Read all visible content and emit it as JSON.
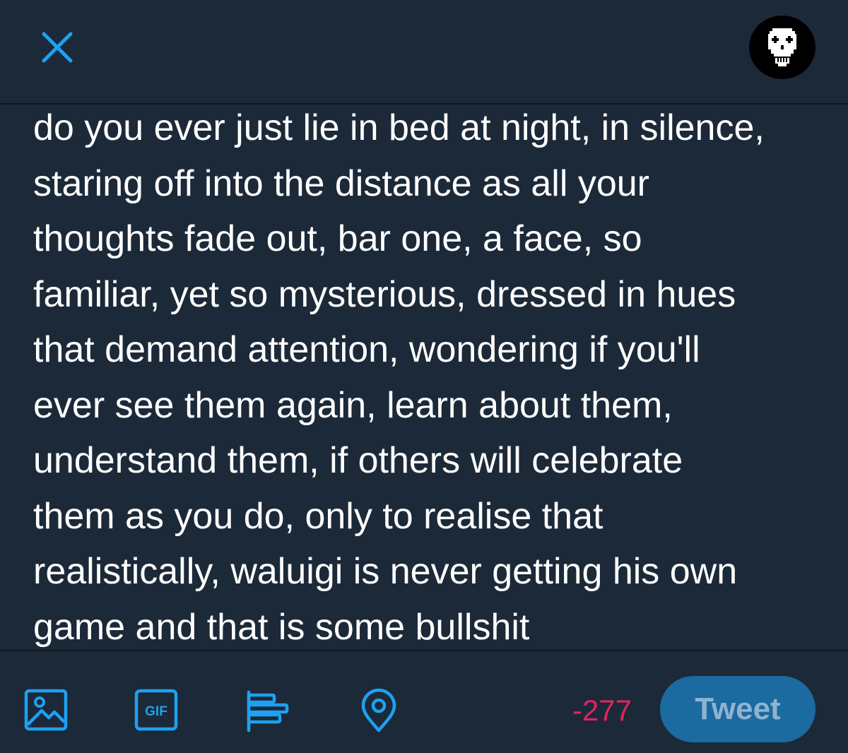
{
  "colors": {
    "background": "#1c2938",
    "accent": "#1da1f2",
    "divider": "#0f1720",
    "counter_over_limit": "#e0245e",
    "tweet_button_disabled": "#1b6aa0"
  },
  "header": {
    "close_icon": "close-icon",
    "avatar_icon": "pixel-skull-avatar"
  },
  "compose": {
    "text": "do you ever just lie in bed at night, in silence,\nstaring off into the distance as all your\nthoughts fade out, bar one, a face, so\nfamiliar, yet so mysterious, dressed in hues\nthat demand attention, wondering if you'll\never see them again, learn about them,\nunderstand them, if others will celebrate\nthem as you do, only to realise that\nrealistically, waluigi is never getting his own\ngame and that is some bullshit"
  },
  "toolbar": {
    "icons": [
      "image-icon",
      "gif-icon",
      "poll-icon",
      "location-icon"
    ],
    "gif_label": "GIF",
    "char_count": "-277",
    "tweet_label": "Tweet"
  }
}
